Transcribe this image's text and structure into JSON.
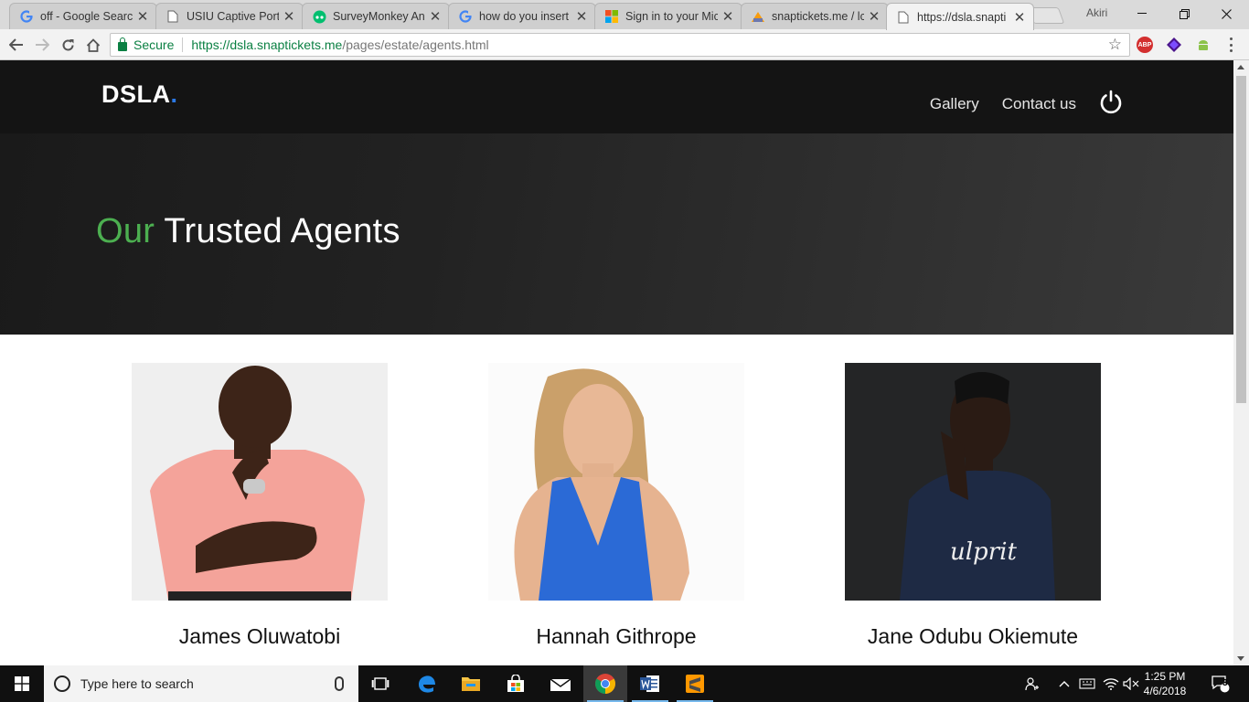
{
  "browser": {
    "tabs": [
      {
        "title": "off - Google Searc",
        "favicon": "google-icon",
        "active": false
      },
      {
        "title": "USIU Captive Porta",
        "favicon": "page-icon",
        "active": false
      },
      {
        "title": "SurveyMonkey An",
        "favicon": "surveymonkey-icon",
        "active": false
      },
      {
        "title": "how do you insert",
        "favicon": "google-icon",
        "active": false
      },
      {
        "title": "Sign in to your Mic",
        "favicon": "microsoft-icon",
        "active": false
      },
      {
        "title": "snaptickets.me / lc",
        "favicon": "phpmyadmin-icon",
        "active": false
      },
      {
        "title": "https://dsla.snapti",
        "favicon": "page-icon",
        "active": true
      }
    ],
    "profile_name": "Akiri",
    "close_glyph": "✕",
    "address": {
      "secure_label": "Secure",
      "url_host": "https://dsla.snaptickets.me",
      "url_path": "/pages/estate/agents.html"
    },
    "extensions": [
      "adblock-plus-icon",
      "extension-purple-icon",
      "android-icon"
    ],
    "ext_abp_label": "ABP"
  },
  "site": {
    "logo": "DSLA",
    "logo_dot": ".",
    "nav": {
      "gallery": "Gallery",
      "contact": "Contact us"
    },
    "hero": {
      "title_accent": "Our",
      "title_rest": "Trusted Agents"
    },
    "agents": [
      {
        "name": "James Oluwatobi",
        "photo": "agent-photo-man-pink-shirt"
      },
      {
        "name": "Hannah Githrope",
        "photo": "agent-photo-woman-blue-top"
      },
      {
        "name": "Jane Odubu Okiemute",
        "photo": "agent-photo-man-dark-tee"
      }
    ],
    "colors": {
      "accent_green": "#4caf50",
      "logo_dot_blue": "#2b78e4",
      "header_bg": "#141414"
    }
  },
  "taskbar": {
    "search_placeholder": "Type here to search",
    "time": "1:25 PM",
    "date": "4/6/2018",
    "notification_count": "3"
  }
}
